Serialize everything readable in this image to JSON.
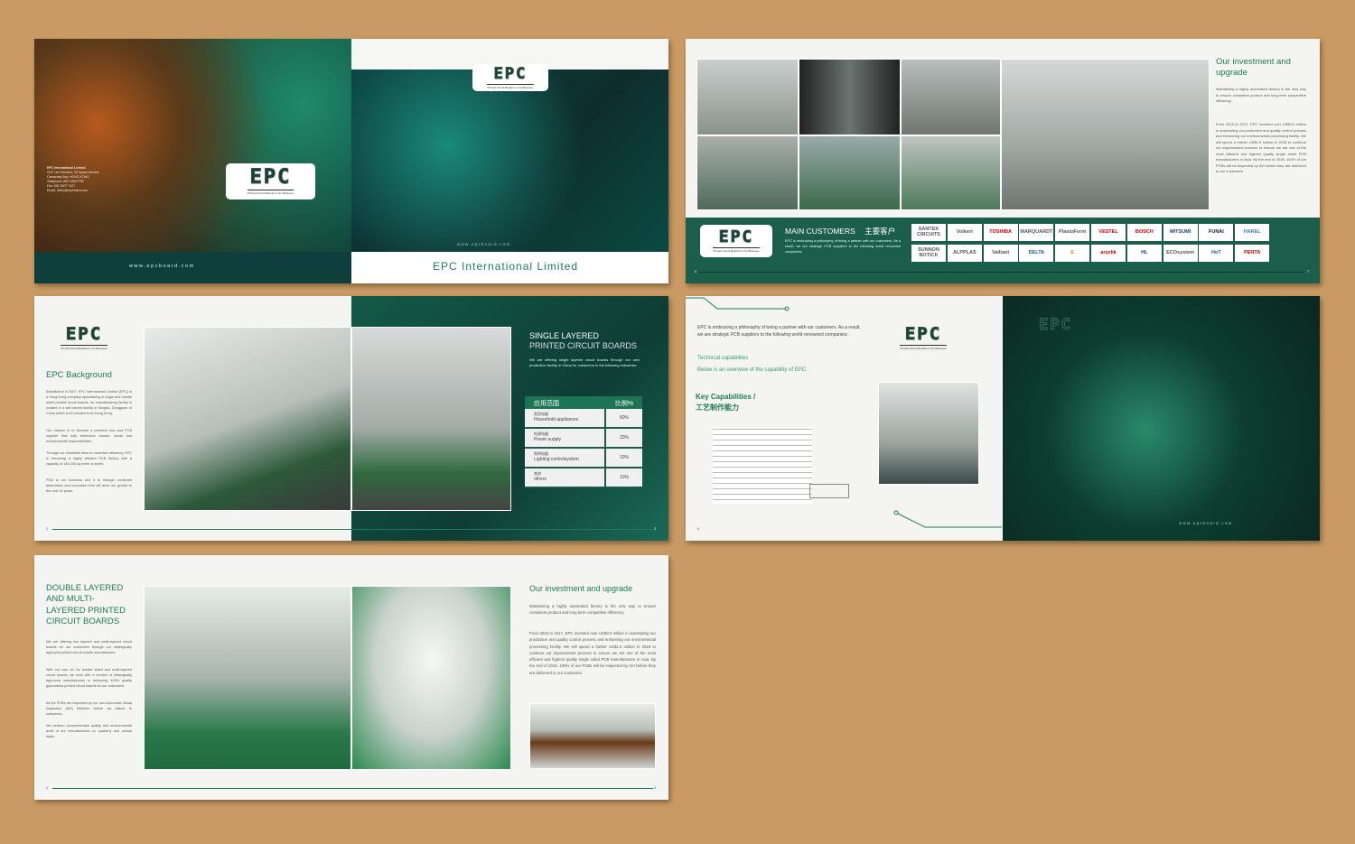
{
  "brand": {
    "logo": "EPC",
    "tagline": "Printed Circuit Boards is Our Business",
    "website": "w w w . e p c b o a r d . c o m",
    "company": "EPC International Limited"
  },
  "cover": {
    "contact": {
      "name": "EPC International Limited",
      "address1": "41/F Lee Gardens, 33 Hysan Avenue",
      "address2": "Causeway Bay, HONG KONG",
      "telephone": "Telephone: 852 23507755",
      "fax": "Fax: 852 3007 7427",
      "email": "Email: Sales@epcboard.com"
    }
  },
  "spread2": {
    "title": "Our investment and upgrade",
    "p1": "Maintaining a highly automated factory is the only way to ensure consistent product and long term competitive efficiency.",
    "p2": "From 2015 to 2017, EPC invested over US$3.5 million in automating our production and quality control process and enhancing our environmental processing facility. We will spend a further US$1.5 million in 2018 to continue our improvement process to ensure we are one of the most efficient and highest quality single sided PCB manufacturers in Asia. By the end of 2018, 100% of our PCBs will be inspected by AVI before they are delivered to our customers.",
    "customers_title": "MAIN CUSTOMERS",
    "customers_title_cn": "主要客户",
    "customers_text": "EPC is embracing a philosophy of being a partner with our customers. As a result, we are strategic PCB suppliers to the following world renowned companies:",
    "customers": [
      "SANTEK CIRCUITS",
      "Volkert",
      "TOSHIBA",
      "MARQUARDT",
      "PlastoForm",
      "VESTEL",
      "BOSCH",
      "MITSUMI",
      "FUNAI",
      "HAREL",
      "SUNNON BOTICK",
      "ALPPLAS",
      "Vaillant",
      "DELTA",
      "E",
      "arçelik",
      "HL",
      "ECOsystem",
      "HoT",
      "PENTA"
    ],
    "page_left": "6",
    "page_right": "7"
  },
  "spread3": {
    "bg_title": "EPC Background",
    "p1": "Established in 2007, EPC International Limited (EPC) is a Hong Kong company specializing in single and double sided printed circuit boards. Its manufacturing facility is located in a self-owned facility in Tangxia, Dongguan of China which is 50 minutes from Hong Kong.",
    "p2": "Our mission is to become a premium low cost PCB supplier that fully embraces human, social and environmental responsibilities.",
    "p3": "Through our insatiable drive to maximise efficiency, EPC is becoming a highly efficient PCB factory with a capacity of 140,000 sq meter a month.",
    "p4": "PCB is our business and it is through continued automation and innovation that will drive our growth in the next 10 years.",
    "single_title1": "SINGLE LAYERED",
    "single_title2": "PRINTED CIRCUIT BOARDS",
    "single_text": "We are offering single layered circuit boards through our own production facility in China for customers in the following industries:",
    "table": {
      "h1": "应用范围",
      "h2": "比例%",
      "rows": [
        {
          "cn": "家用电器",
          "en": "Household appliances",
          "pct": "60%"
        },
        {
          "cn": "电源电器",
          "en": "Power supply",
          "pct": "20%"
        },
        {
          "cn": "照明电器",
          "en": "Lighting controlsystem",
          "pct": "10%"
        },
        {
          "cn": "其他",
          "en": "others",
          "pct": "10%"
        }
      ]
    },
    "page_left": "2",
    "page_right": "3"
  },
  "spread4": {
    "intro": "EPC is embracing a philosophy of being a partner with our customers. As a result, we are strategic PCB suppliers to the following world renowned companies:",
    "tech": "Technical capabilities",
    "overview": "Below is an overview of the capability of EPC.",
    "key1": "Key Capabilities /",
    "key2": "工艺制作能力",
    "page_left": "8"
  },
  "spread5": {
    "title": "DOUBLE LAYERED AND MULTI-LAYERED PRINTED CIRCUIT BOARDS",
    "p1": "We are offering two layered and multi-layered circuit boards for our customers through our strategically approved printed circuit boards manufactures.",
    "p2": "With our own UL for double sided and multi-layered circuit boards, we work with a number of strategically approved manufacturers in delivering 100% quality guaranteed printed circuit boards for our customers.",
    "p3": "All the PCBs are inspected by our own Automatic Visual Inspection (AVI) Machine before we deliver to customers.",
    "p4": "We perform comprehensive quality and environmental audit of our manufacturers on quarterly and annual basis.",
    "inv_title": "Our investment and upgrade",
    "inv_p1": "Maintaining a highly automated factory is the only way to ensure consistent product and long term competitive efficiency.",
    "inv_p2": "From 2015 to 2017, EPC invested over US$3.5 million in automating our production and quality control process and enhancing our environmental processing facility. We will spend a further US$1.5 million in 2018 to continue our improvement process to ensure we are one of the most efficient and highest quality single sided PCB manufacturers in Asia. By the end of 2018, 100% of our PCBs will be inspected by AVI before they are delivered to our customers.",
    "page_left": "4",
    "page_right": "5"
  }
}
